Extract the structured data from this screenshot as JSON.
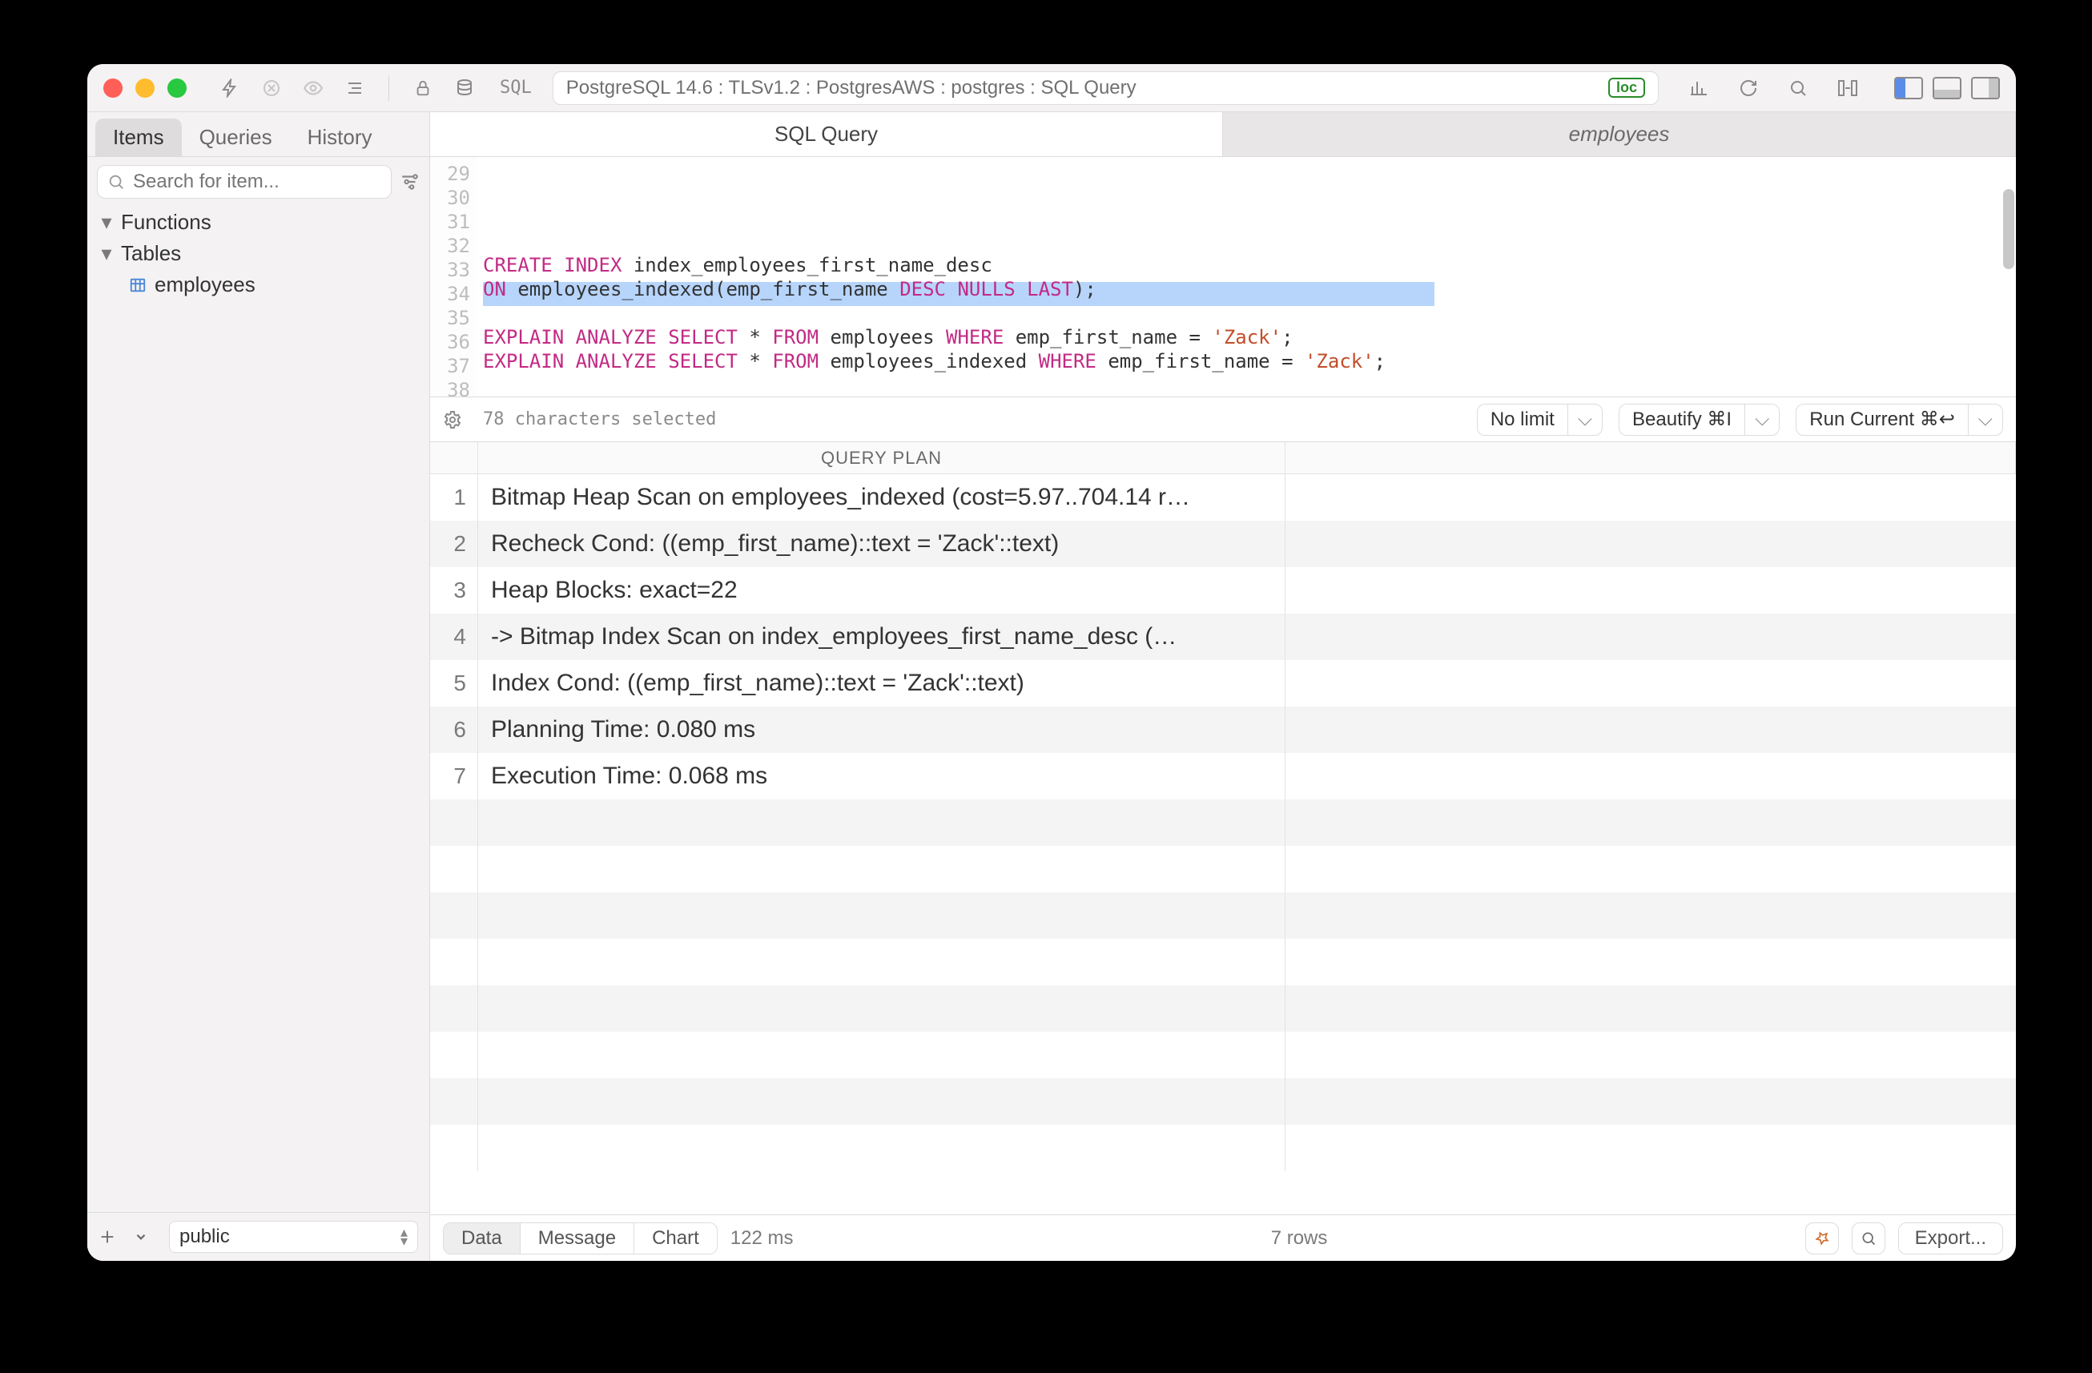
{
  "titlebar": {
    "sql_badge": "SQL",
    "connection": "PostgreSQL 14.6 : TLSv1.2 : PostgresAWS : postgres : SQL Query",
    "loc_badge": "loc"
  },
  "sidebar": {
    "tabs": {
      "items": "Items",
      "queries": "Queries",
      "history": "History"
    },
    "search_placeholder": "Search for item...",
    "tree": {
      "functions": "Functions",
      "tables": "Tables",
      "tables_children": [
        "employees"
      ]
    },
    "schema": "public"
  },
  "main_tabs": {
    "sql": "SQL Query",
    "employees": "employees"
  },
  "editor": {
    "first_line_no": 29,
    "line_count": 10,
    "lines": [
      {
        "n": 29,
        "tokens": []
      },
      {
        "n": 30,
        "tokens": [
          {
            "t": "CREATE",
            "c": "kw"
          },
          {
            "t": " "
          },
          {
            "t": "INDEX",
            "c": "kw"
          },
          {
            "t": " index_employees_first_name_desc"
          }
        ]
      },
      {
        "n": 31,
        "tokens": [
          {
            "t": "ON",
            "c": "kw"
          },
          {
            "t": " employees_indexed(emp_first_name "
          },
          {
            "t": "DESC",
            "c": "kw"
          },
          {
            "t": " "
          },
          {
            "t": "NULLS",
            "c": "kw"
          },
          {
            "t": " "
          },
          {
            "t": "LAST",
            "c": "kw"
          },
          {
            "t": ");"
          }
        ]
      },
      {
        "n": 32,
        "tokens": []
      },
      {
        "n": 33,
        "tokens": [
          {
            "t": "EXPLAIN",
            "c": "kw"
          },
          {
            "t": " "
          },
          {
            "t": "ANALYZE",
            "c": "kw"
          },
          {
            "t": " "
          },
          {
            "t": "SELECT",
            "c": "kw"
          },
          {
            "t": " * "
          },
          {
            "t": "FROM",
            "c": "kw"
          },
          {
            "t": " employees "
          },
          {
            "t": "WHERE",
            "c": "kw"
          },
          {
            "t": " emp_first_name = "
          },
          {
            "t": "'Zack'",
            "c": "string"
          },
          {
            "t": ";"
          }
        ]
      },
      {
        "n": 34,
        "tokens": [
          {
            "t": "EXPLAIN",
            "c": "kw"
          },
          {
            "t": " "
          },
          {
            "t": "ANALYZE",
            "c": "kw"
          },
          {
            "t": " "
          },
          {
            "t": "SELECT",
            "c": "kw"
          },
          {
            "t": " * "
          },
          {
            "t": "FROM",
            "c": "kw"
          },
          {
            "t": " employees_indexed "
          },
          {
            "t": "WHERE",
            "c": "kw"
          },
          {
            "t": " emp_first_name = "
          },
          {
            "t": "'Zack'",
            "c": "string"
          },
          {
            "t": ";"
          }
        ]
      },
      {
        "n": 35,
        "tokens": []
      },
      {
        "n": 36,
        "tokens": []
      },
      {
        "n": 37,
        "tokens": []
      },
      {
        "n": 38,
        "tokens": []
      }
    ],
    "status": "78 characters selected",
    "limit": "No limit",
    "beautify": "Beautify ⌘I",
    "run": "Run Current ⌘↩"
  },
  "results": {
    "header": "QUERY PLAN",
    "rows": [
      "Bitmap Heap Scan on employees_indexed  (cost=5.97..704.14 r…",
      "  Recheck Cond: ((emp_first_name)::text = 'Zack'::text)",
      "  Heap Blocks: exact=22",
      "  ->  Bitmap Index Scan on index_employees_first_name_desc  (…",
      "        Index Cond: ((emp_first_name)::text = 'Zack'::text)",
      "Planning Time: 0.080 ms",
      "Execution Time: 0.068 ms"
    ]
  },
  "bottombar": {
    "seg": {
      "data": "Data",
      "message": "Message",
      "chart": "Chart"
    },
    "elapsed": "122 ms",
    "rows": "7 rows",
    "export": "Export..."
  }
}
